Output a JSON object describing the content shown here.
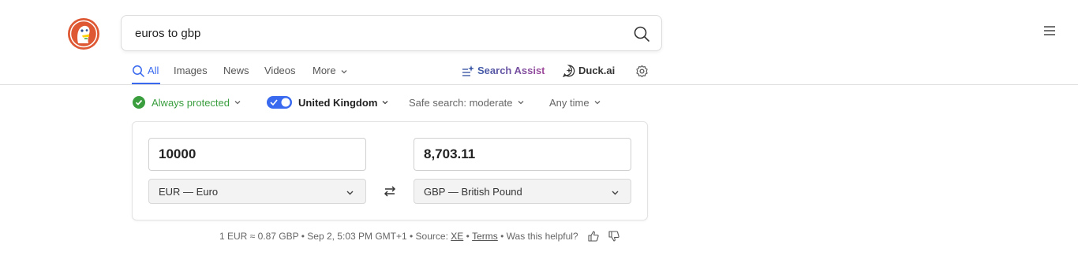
{
  "search": {
    "query": "euros to gbp"
  },
  "tabs": [
    {
      "label": "All"
    },
    {
      "label": "Images"
    },
    {
      "label": "News"
    },
    {
      "label": "Videos"
    },
    {
      "label": "More"
    }
  ],
  "assist": {
    "search_assist": "Search Assist",
    "duck_ai": "Duck.ai"
  },
  "filters": {
    "protection": "Always protected",
    "region": "United Kingdom",
    "safe_search": "Safe search: moderate",
    "time": "Any time"
  },
  "converter": {
    "from_amount": "10000",
    "to_amount": "8,703.11",
    "from_currency": "EUR — Euro",
    "to_currency": "GBP — British Pound"
  },
  "footer": {
    "rate": "1 EUR ≈ 0.87 GBP • Sep 2, 5:03 PM GMT+1 • Source: ",
    "source": "XE",
    "sep": " • ",
    "terms": "Terms",
    "helpful": " • Was this helpful?"
  },
  "colors": {
    "accent": "#3969ef",
    "protected_green": "#3a9e3f",
    "logo_orange": "#de5833"
  }
}
